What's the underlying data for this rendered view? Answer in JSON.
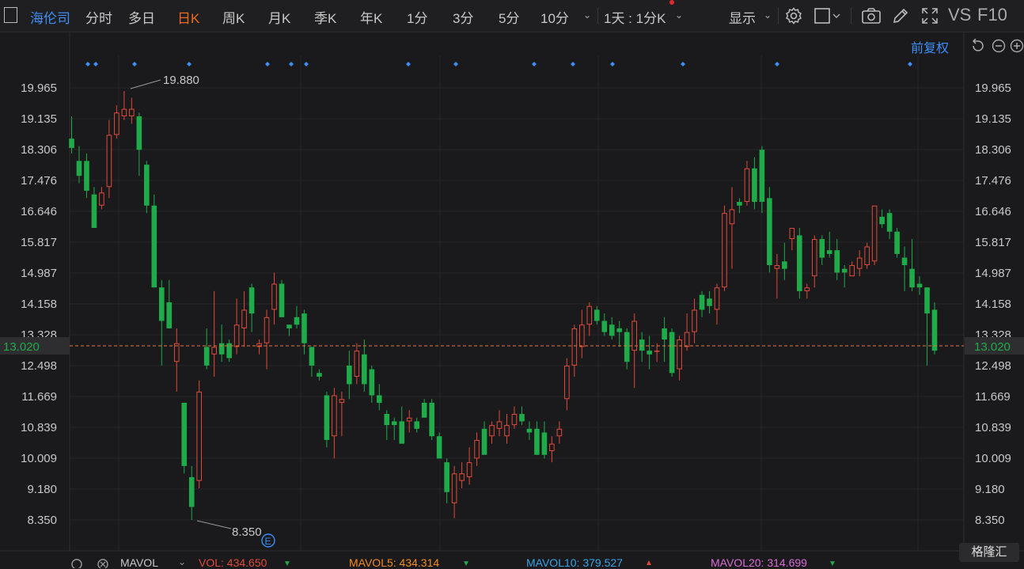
{
  "toolbar": {
    "stock_name": "海伦司",
    "periods": [
      {
        "label": "分时",
        "active": false
      },
      {
        "label": "多日",
        "active": false
      },
      {
        "label": "日K",
        "active": true
      },
      {
        "label": "周K",
        "active": false
      },
      {
        "label": "月K",
        "active": false
      },
      {
        "label": "季K",
        "active": false
      },
      {
        "label": "年K",
        "active": false
      },
      {
        "label": "1分",
        "active": false
      },
      {
        "label": "3分",
        "active": false
      },
      {
        "label": "5分",
        "active": false
      },
      {
        "label": "10分",
        "active": false
      }
    ],
    "intraday_select": "1天 : 1分K",
    "display_label": "显示",
    "vs_label": "VS",
    "f10_label": "F10"
  },
  "adjust_label": "前复权",
  "price_axis": {
    "labels": [
      "19.965",
      "19.135",
      "18.306",
      "17.476",
      "16.646",
      "15.817",
      "14.987",
      "14.158",
      "13.328",
      "12.498",
      "11.669",
      "10.839",
      "10.009",
      "9.180",
      "8.350"
    ],
    "current_price": "13.020"
  },
  "annotations": {
    "high_label": "19.880",
    "low_label": "8.350",
    "event_marker": "E"
  },
  "indicators": {
    "name": "MAVOL",
    "vol_label": "VOL: 434.650",
    "mavol5_label": "MAVOL5: 434.314",
    "mavol10_label": "MAVOL10: 379.527",
    "mavol20_label": "MAVOL20: 314.699"
  },
  "watermark": "格隆汇",
  "colors": {
    "up": "#e04a3a",
    "down": "#1fab4a",
    "current_line": "#e8773a",
    "accent": "#3d8ef7",
    "mavol5": "#f08a24",
    "mavol10": "#36a3e6",
    "mavol20": "#d86bd6"
  },
  "chart_data": {
    "type": "candlestick",
    "ylim": [
      7.9,
      20.6
    ],
    "ticks": [
      19.965,
      19.135,
      18.306,
      17.476,
      16.646,
      15.817,
      14.987,
      14.158,
      13.328,
      12.498,
      11.669,
      10.839,
      10.009,
      9.18,
      8.35
    ],
    "current_price": 13.02,
    "candles": [
      {
        "o": 18.6,
        "h": 19.2,
        "l": 18.2,
        "c": 18.35
      },
      {
        "o": 18.0,
        "h": 18.4,
        "l": 17.4,
        "c": 17.6
      },
      {
        "o": 18.0,
        "h": 18.2,
        "l": 17.0,
        "c": 17.2
      },
      {
        "o": 17.1,
        "h": 17.3,
        "l": 16.2,
        "c": 16.2
      },
      {
        "o": 16.8,
        "h": 17.3,
        "l": 16.7,
        "c": 17.15
      },
      {
        "o": 17.3,
        "h": 19.1,
        "l": 17.0,
        "c": 18.7
      },
      {
        "o": 18.7,
        "h": 19.5,
        "l": 18.6,
        "c": 19.3
      },
      {
        "o": 19.2,
        "h": 19.88,
        "l": 19.1,
        "c": 19.4
      },
      {
        "o": 19.2,
        "h": 19.7,
        "l": 19.0,
        "c": 19.4
      },
      {
        "o": 19.2,
        "h": 19.3,
        "l": 17.6,
        "c": 18.3
      },
      {
        "o": 17.9,
        "h": 18.0,
        "l": 16.6,
        "c": 16.8
      },
      {
        "o": 16.8,
        "h": 17.1,
        "l": 14.6,
        "c": 14.6
      },
      {
        "o": 14.6,
        "h": 14.8,
        "l": 12.5,
        "c": 13.7
      },
      {
        "o": 14.2,
        "h": 14.8,
        "l": 13.5,
        "c": 13.5
      },
      {
        "o": 12.6,
        "h": 13.5,
        "l": 11.8,
        "c": 13.1
      },
      {
        "o": 11.5,
        "h": 11.5,
        "l": 9.6,
        "c": 9.8
      },
      {
        "o": 9.5,
        "h": 9.8,
        "l": 8.35,
        "c": 8.7
      },
      {
        "o": 9.4,
        "h": 12.1,
        "l": 9.2,
        "c": 11.8
      },
      {
        "o": 13.0,
        "h": 13.5,
        "l": 12.4,
        "c": 12.5
      },
      {
        "o": 12.8,
        "h": 14.5,
        "l": 12.2,
        "c": 13.0
      },
      {
        "o": 13.1,
        "h": 13.6,
        "l": 12.6,
        "c": 12.8
      },
      {
        "o": 13.1,
        "h": 13.2,
        "l": 12.6,
        "c": 12.7
      },
      {
        "o": 13.0,
        "h": 14.3,
        "l": 12.8,
        "c": 13.6
      },
      {
        "o": 13.5,
        "h": 14.5,
        "l": 13.0,
        "c": 14.0
      },
      {
        "o": 14.6,
        "h": 14.7,
        "l": 13.4,
        "c": 13.9
      },
      {
        "o": 13.0,
        "h": 13.2,
        "l": 12.8,
        "c": 13.1
      },
      {
        "o": 13.1,
        "h": 14.0,
        "l": 12.4,
        "c": 13.8
      },
      {
        "o": 14.0,
        "h": 15.0,
        "l": 13.6,
        "c": 14.7
      },
      {
        "o": 14.7,
        "h": 14.8,
        "l": 13.8,
        "c": 13.8
      },
      {
        "o": 13.6,
        "h": 13.6,
        "l": 13.3,
        "c": 13.5
      },
      {
        "o": 13.8,
        "h": 14.1,
        "l": 13.5,
        "c": 13.6
      },
      {
        "o": 13.9,
        "h": 14.0,
        "l": 12.8,
        "c": 13.1
      },
      {
        "o": 13.0,
        "h": 13.0,
        "l": 12.2,
        "c": 12.5
      },
      {
        "o": 12.3,
        "h": 12.4,
        "l": 12.1,
        "c": 12.2
      },
      {
        "o": 11.7,
        "h": 11.8,
        "l": 10.3,
        "c": 10.5
      },
      {
        "o": 10.6,
        "h": 11.9,
        "l": 10.0,
        "c": 11.7
      },
      {
        "o": 11.5,
        "h": 11.8,
        "l": 10.6,
        "c": 11.6
      },
      {
        "o": 12.5,
        "h": 12.9,
        "l": 11.6,
        "c": 12.0
      },
      {
        "o": 12.2,
        "h": 13.1,
        "l": 12.0,
        "c": 12.9
      },
      {
        "o": 12.8,
        "h": 13.2,
        "l": 11.8,
        "c": 12.0
      },
      {
        "o": 12.4,
        "h": 12.5,
        "l": 11.5,
        "c": 11.7
      },
      {
        "o": 11.7,
        "h": 12.0,
        "l": 11.3,
        "c": 11.5
      },
      {
        "o": 11.2,
        "h": 11.3,
        "l": 10.5,
        "c": 10.9
      },
      {
        "o": 11.0,
        "h": 11.1,
        "l": 10.5,
        "c": 10.9
      },
      {
        "o": 11.0,
        "h": 11.4,
        "l": 10.4,
        "c": 10.4
      },
      {
        "o": 11.0,
        "h": 11.3,
        "l": 10.7,
        "c": 11.1
      },
      {
        "o": 11.0,
        "h": 11.1,
        "l": 10.7,
        "c": 10.8
      },
      {
        "o": 11.5,
        "h": 11.6,
        "l": 11.1,
        "c": 11.1
      },
      {
        "o": 11.5,
        "h": 11.6,
        "l": 10.5,
        "c": 10.6
      },
      {
        "o": 10.6,
        "h": 10.7,
        "l": 10.0,
        "c": 10.0
      },
      {
        "o": 9.9,
        "h": 10.0,
        "l": 8.8,
        "c": 9.1
      },
      {
        "o": 8.8,
        "h": 9.8,
        "l": 8.4,
        "c": 9.6
      },
      {
        "o": 9.4,
        "h": 9.9,
        "l": 9.2,
        "c": 9.6
      },
      {
        "o": 9.5,
        "h": 10.3,
        "l": 9.3,
        "c": 9.9
      },
      {
        "o": 10.0,
        "h": 10.7,
        "l": 9.8,
        "c": 10.5
      },
      {
        "o": 10.8,
        "h": 11.0,
        "l": 10.2,
        "c": 10.1
      },
      {
        "o": 10.6,
        "h": 11.0,
        "l": 10.4,
        "c": 10.9
      },
      {
        "o": 10.8,
        "h": 11.3,
        "l": 10.6,
        "c": 11.0
      },
      {
        "o": 10.6,
        "h": 11.2,
        "l": 10.4,
        "c": 10.9
      },
      {
        "o": 10.9,
        "h": 11.4,
        "l": 10.8,
        "c": 11.2
      },
      {
        "o": 11.2,
        "h": 11.4,
        "l": 10.9,
        "c": 11.0
      },
      {
        "o": 10.8,
        "h": 11.0,
        "l": 10.5,
        "c": 10.7
      },
      {
        "o": 10.8,
        "h": 11.0,
        "l": 10.1,
        "c": 10.1
      },
      {
        "o": 10.7,
        "h": 11.0,
        "l": 10.0,
        "c": 10.1
      },
      {
        "o": 10.2,
        "h": 10.6,
        "l": 9.9,
        "c": 10.4
      },
      {
        "o": 10.6,
        "h": 11.0,
        "l": 10.4,
        "c": 10.8
      },
      {
        "o": 11.6,
        "h": 12.7,
        "l": 11.3,
        "c": 12.5
      },
      {
        "o": 12.5,
        "h": 13.6,
        "l": 12.2,
        "c": 13.5
      },
      {
        "o": 13.0,
        "h": 14.0,
        "l": 12.7,
        "c": 13.6
      },
      {
        "o": 13.6,
        "h": 14.2,
        "l": 13.3,
        "c": 14.1
      },
      {
        "o": 14.0,
        "h": 14.1,
        "l": 13.6,
        "c": 13.7
      },
      {
        "o": 13.7,
        "h": 13.9,
        "l": 13.3,
        "c": 13.4
      },
      {
        "o": 13.6,
        "h": 13.8,
        "l": 13.2,
        "c": 13.3
      },
      {
        "o": 13.5,
        "h": 13.7,
        "l": 13.0,
        "c": 13.4
      },
      {
        "o": 13.4,
        "h": 13.5,
        "l": 12.4,
        "c": 12.6
      },
      {
        "o": 12.9,
        "h": 13.9,
        "l": 11.9,
        "c": 13.7
      },
      {
        "o": 13.2,
        "h": 13.4,
        "l": 12.6,
        "c": 12.9
      },
      {
        "o": 12.9,
        "h": 13.3,
        "l": 12.4,
        "c": 12.8
      },
      {
        "o": 12.9,
        "h": 13.1,
        "l": 12.6,
        "c": 12.9
      },
      {
        "o": 13.5,
        "h": 13.8,
        "l": 12.6,
        "c": 13.2
      },
      {
        "o": 13.4,
        "h": 13.5,
        "l": 12.2,
        "c": 12.3
      },
      {
        "o": 12.4,
        "h": 13.3,
        "l": 12.1,
        "c": 13.2
      },
      {
        "o": 13.0,
        "h": 13.9,
        "l": 12.9,
        "c": 13.4
      },
      {
        "o": 13.4,
        "h": 14.3,
        "l": 13.1,
        "c": 14.0
      },
      {
        "o": 14.4,
        "h": 14.5,
        "l": 13.8,
        "c": 14.0
      },
      {
        "o": 14.3,
        "h": 14.5,
        "l": 13.9,
        "c": 14.1
      },
      {
        "o": 14.0,
        "h": 14.7,
        "l": 13.6,
        "c": 14.6
      },
      {
        "o": 14.6,
        "h": 16.8,
        "l": 14.5,
        "c": 16.6
      },
      {
        "o": 16.3,
        "h": 17.3,
        "l": 15.1,
        "c": 16.7
      },
      {
        "o": 16.9,
        "h": 17.0,
        "l": 16.6,
        "c": 16.8
      },
      {
        "o": 16.9,
        "h": 18.0,
        "l": 16.8,
        "c": 17.8
      },
      {
        "o": 17.8,
        "h": 18.1,
        "l": 16.7,
        "c": 16.9
      },
      {
        "o": 18.3,
        "h": 18.4,
        "l": 16.6,
        "c": 16.9
      },
      {
        "o": 17.0,
        "h": 17.3,
        "l": 15.0,
        "c": 15.2
      },
      {
        "o": 15.1,
        "h": 15.5,
        "l": 14.3,
        "c": 15.2
      },
      {
        "o": 15.3,
        "h": 15.8,
        "l": 14.8,
        "c": 15.1
      },
      {
        "o": 15.9,
        "h": 16.2,
        "l": 15.6,
        "c": 16.2
      },
      {
        "o": 16.0,
        "h": 16.2,
        "l": 14.3,
        "c": 14.5
      },
      {
        "o": 14.5,
        "h": 14.7,
        "l": 14.3,
        "c": 14.6
      },
      {
        "o": 14.9,
        "h": 16.0,
        "l": 14.6,
        "c": 15.9
      },
      {
        "o": 15.9,
        "h": 16.0,
        "l": 15.2,
        "c": 15.4
      },
      {
        "o": 15.6,
        "h": 16.1,
        "l": 15.4,
        "c": 15.5
      },
      {
        "o": 15.6,
        "h": 15.9,
        "l": 14.8,
        "c": 15.0
      },
      {
        "o": 15.1,
        "h": 15.2,
        "l": 14.6,
        "c": 15.0
      },
      {
        "o": 14.9,
        "h": 15.3,
        "l": 14.9,
        "c": 15.2
      },
      {
        "o": 15.1,
        "h": 15.6,
        "l": 14.9,
        "c": 15.4
      },
      {
        "o": 15.2,
        "h": 15.8,
        "l": 15.1,
        "c": 15.7
      },
      {
        "o": 15.3,
        "h": 16.8,
        "l": 15.2,
        "c": 16.8
      },
      {
        "o": 16.5,
        "h": 16.7,
        "l": 16.2,
        "c": 16.3
      },
      {
        "o": 16.6,
        "h": 16.7,
        "l": 15.9,
        "c": 16.1
      },
      {
        "o": 16.1,
        "h": 16.2,
        "l": 15.4,
        "c": 15.5
      },
      {
        "o": 15.4,
        "h": 15.7,
        "l": 14.5,
        "c": 15.2
      },
      {
        "o": 15.1,
        "h": 15.9,
        "l": 14.5,
        "c": 14.6
      },
      {
        "o": 14.7,
        "h": 14.9,
        "l": 14.4,
        "c": 14.6
      },
      {
        "o": 14.6,
        "h": 14.6,
        "l": 12.5,
        "c": 13.9
      },
      {
        "o": 14.0,
        "h": 14.2,
        "l": 12.8,
        "c": 12.9
      }
    ]
  }
}
